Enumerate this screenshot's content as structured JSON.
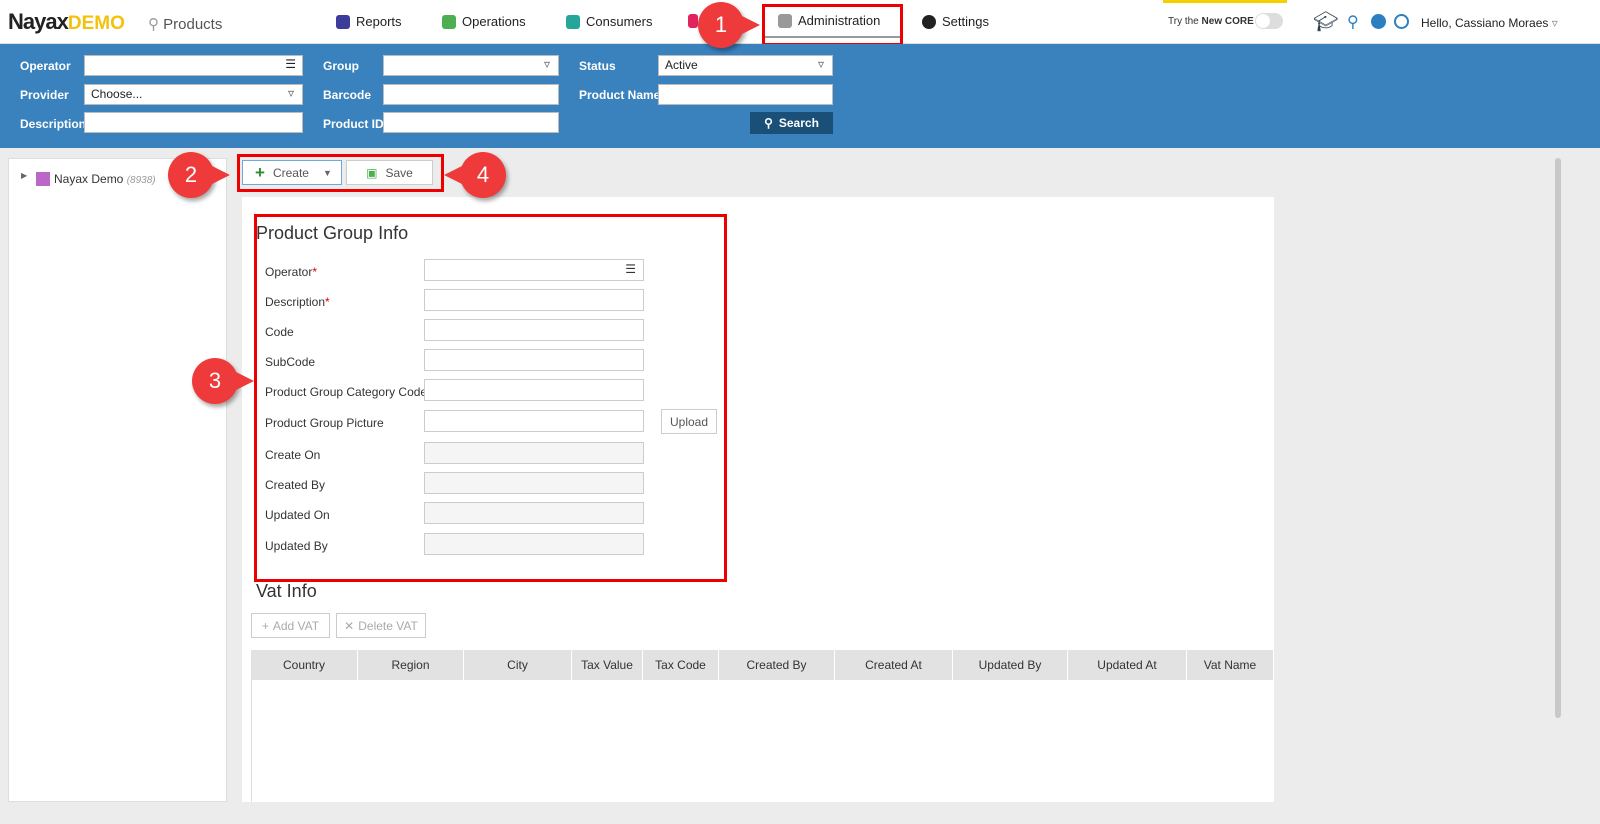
{
  "header": {
    "logo": "Nayax",
    "logo_suffix": "DEMO",
    "page": "Products",
    "nav": [
      {
        "label": "Reports",
        "color": "#3c3c9a"
      },
      {
        "label": "Operations",
        "color": "#4caf50"
      },
      {
        "label": "Consumers",
        "color": "#26a69a"
      },
      {
        "label": "Administration",
        "color": "#999999"
      },
      {
        "label": "Settings",
        "color": "#222222"
      }
    ],
    "try_core": "Try the",
    "try_core_bold": "New CORE",
    "greeting": "Hello, Cassiano Moraes"
  },
  "filter": {
    "operator": "Operator",
    "group": "Group",
    "status": "Status",
    "status_value": "Active",
    "provider": "Provider",
    "provider_value": "Choose...",
    "barcode": "Barcode",
    "product_name": "Product Name",
    "description": "Description",
    "product_id": "Product ID",
    "search": "Search"
  },
  "tree": {
    "root": "Nayax Demo",
    "count": "(8938)"
  },
  "toolbar": {
    "create": "Create",
    "save": "Save"
  },
  "form": {
    "title": "Product Group Info",
    "fields": [
      {
        "label": "Operator",
        "required": "*"
      },
      {
        "label": "Description",
        "required": "*"
      },
      {
        "label": "Code"
      },
      {
        "label": "SubCode"
      },
      {
        "label": "Product Group Category Code"
      },
      {
        "label": "Product Group Picture"
      },
      {
        "label": "Create On"
      },
      {
        "label": "Created By"
      },
      {
        "label": "Updated On"
      },
      {
        "label": "Updated By"
      }
    ],
    "upload": "Upload"
  },
  "vat": {
    "title": "Vat Info",
    "add": "Add VAT",
    "delete": "Delete VAT",
    "columns": [
      "Country",
      "Region",
      "City",
      "Tax Value",
      "Tax Code",
      "Created By",
      "Created At",
      "Updated By",
      "Updated At",
      "Vat Name"
    ]
  },
  "callouts": [
    "1",
    "2",
    "3",
    "4"
  ]
}
